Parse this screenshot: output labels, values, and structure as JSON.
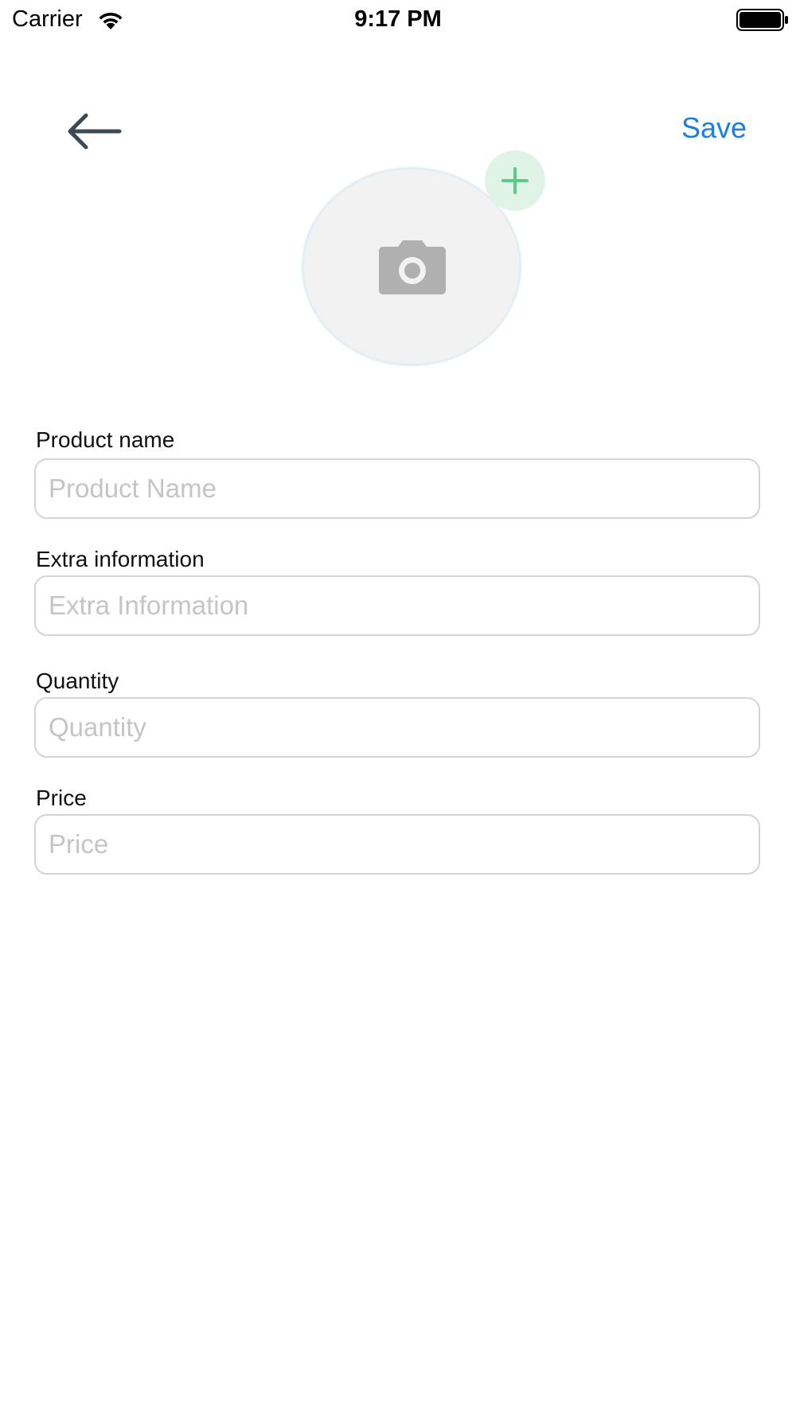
{
  "status_bar": {
    "carrier": "Carrier",
    "time": "9:17 PM",
    "wifi_icon": "wifi-icon",
    "battery_icon": "battery-full-icon"
  },
  "nav": {
    "back_icon": "arrow-left-icon",
    "save_label": "Save",
    "save_color": "#1a7fe0"
  },
  "photo": {
    "camera_icon": "camera-icon",
    "add_icon": "plus-icon",
    "add_color": "#5cc98a"
  },
  "form": {
    "product_name": {
      "label": "Product name",
      "placeholder": "Product Name",
      "value": ""
    },
    "extra_information": {
      "label": "Extra information",
      "placeholder": "Extra Information",
      "value": ""
    },
    "quantity": {
      "label": "Quantity",
      "placeholder": "Quantity",
      "value": ""
    },
    "price": {
      "label": "Price",
      "placeholder": "Price",
      "value": ""
    }
  }
}
